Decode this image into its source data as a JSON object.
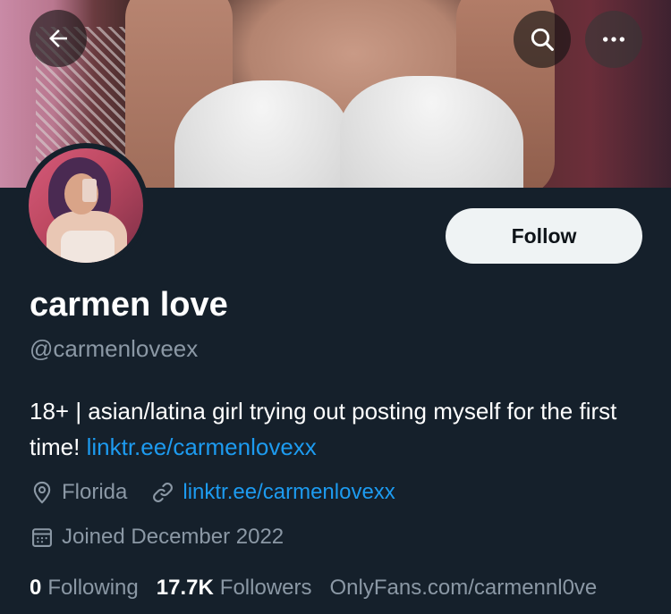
{
  "header": {
    "back_icon": "arrow-left-icon",
    "search_icon": "search-icon",
    "more_icon": "more-horizontal-icon"
  },
  "profile": {
    "display_name": "carmen love",
    "handle": "@carmenloveex",
    "follow_label": "Follow",
    "bio_text": "18+ | asian/latina girl trying out posting myself for the first time! ",
    "bio_link": "linktr.ee/carmenlovexx",
    "location": "Florida",
    "website": "linktr.ee/carmenlovexx",
    "joined": "Joined December 2022",
    "following_count": "0",
    "following_label": "Following",
    "followers_count": "17.7K",
    "followers_label": "Followers",
    "extra_text": "OnlyFans.com/carmennl0ve"
  },
  "colors": {
    "background": "#15202b",
    "link": "#1d9bf0",
    "secondary_text": "#8b98a5",
    "follow_button_bg": "#eff3f4"
  }
}
